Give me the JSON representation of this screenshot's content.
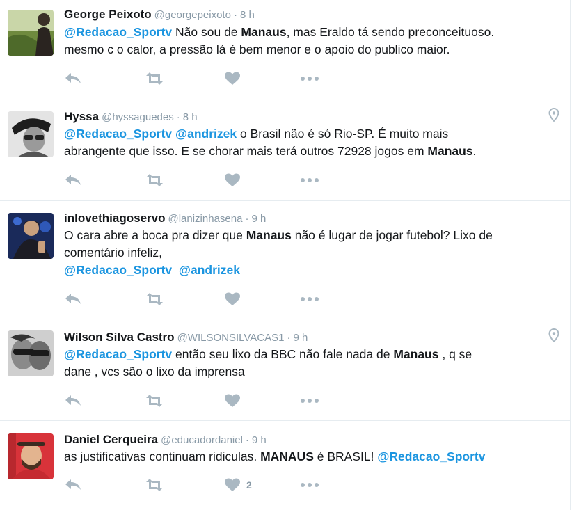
{
  "tweets": [
    {
      "name": "George Peixoto",
      "handle": "@georgepeixoto",
      "time": "8 h",
      "geo": false,
      "likes": "",
      "parts": [
        {
          "t": "@Redacao_Sportv",
          "k": "m"
        },
        {
          "t": " Não sou de ",
          "k": ""
        },
        {
          "t": "Manaus",
          "k": "b"
        },
        {
          "t": ", mas Eraldo tá sendo preconceituoso.\nmesmo c o calor, a pressão lá é bem menor e o apoio do publico maior.",
          "k": ""
        }
      ]
    },
    {
      "name": "Hyssa",
      "handle": "@hyssaguedes",
      "time": "8 h",
      "geo": true,
      "likes": "",
      "parts": [
        {
          "t": "@Redacao_Sportv",
          "k": "m"
        },
        {
          "t": " ",
          "k": ""
        },
        {
          "t": "@andrizek",
          "k": "m"
        },
        {
          "t": " o Brasil não é só Rio-SP. É muito mais\nabrangente que isso. E se chorar mais terá outros 72928 jogos em ",
          "k": ""
        },
        {
          "t": "Manaus",
          "k": "b"
        },
        {
          "t": ".",
          "k": ""
        }
      ]
    },
    {
      "name": "inlovethiagoservo",
      "handle": "@lanizinhasena",
      "time": "9 h",
      "geo": false,
      "likes": "",
      "parts": [
        {
          "t": "O cara abre a boca pra dizer que ",
          "k": ""
        },
        {
          "t": "Manaus",
          "k": "b"
        },
        {
          "t": " não é lugar de jogar futebol? Lixo de\ncomentário infeliz,\n",
          "k": ""
        },
        {
          "t": "@Redacao_Sportv",
          "k": "m"
        },
        {
          "t": "  ",
          "k": ""
        },
        {
          "t": "@andrizek",
          "k": "m"
        }
      ]
    },
    {
      "name": "Wilson Silva Castro",
      "handle": "@WILSONSILVACAS1",
      "time": "9 h",
      "geo": true,
      "likes": "",
      "parts": [
        {
          "t": "@Redacao_Sportv",
          "k": "m"
        },
        {
          "t": " então seu lixo da BBC não fale nada de ",
          "k": ""
        },
        {
          "t": "Manaus",
          "k": "b"
        },
        {
          "t": " , q se\ndane , vcs são o lixo da imprensa",
          "k": ""
        }
      ]
    },
    {
      "name": "Daniel Cerqueira",
      "handle": "@educadordaniel",
      "time": "9 h",
      "geo": false,
      "likes": "2",
      "parts": [
        {
          "t": "as justificativas continuam ridiculas. ",
          "k": ""
        },
        {
          "t": "MANAUS",
          "k": "b"
        },
        {
          "t": " é BRASIL! ",
          "k": ""
        },
        {
          "t": "@Redacao_Sportv",
          "k": "m"
        }
      ]
    }
  ],
  "icons": {
    "reply": "reply-icon",
    "retweet": "retweet-icon",
    "like": "heart-icon",
    "more": "more-icon",
    "geo": "location-pin-icon"
  },
  "colors": {
    "link": "#1b95e0",
    "muted": "#8899a6",
    "icon": "#aab8c2"
  }
}
